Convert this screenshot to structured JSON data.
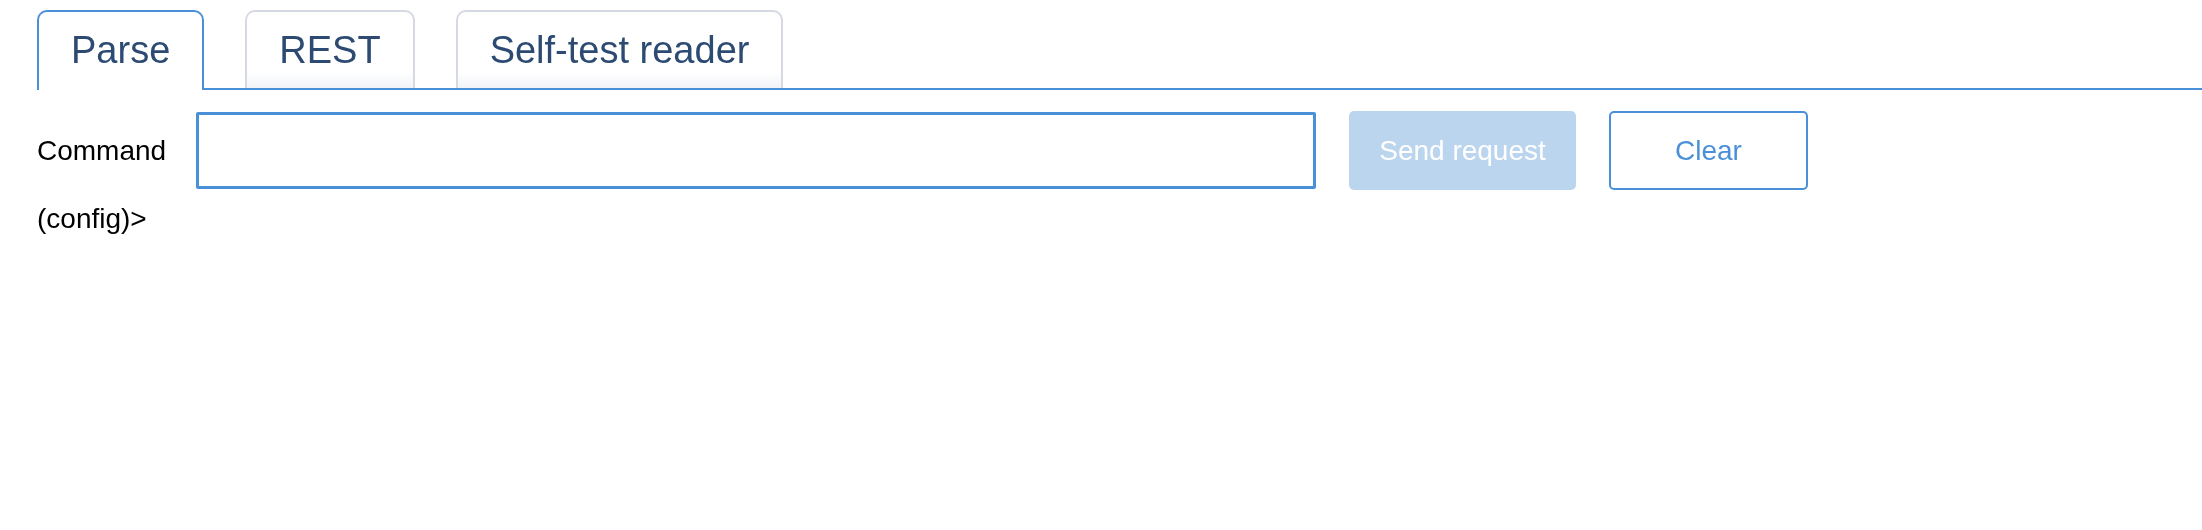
{
  "tabs": [
    {
      "label": "Parse",
      "selected": true
    },
    {
      "label": "REST",
      "selected": false
    },
    {
      "label": "Self-test reader",
      "selected": false
    }
  ],
  "command": {
    "label": "Command",
    "prompt": "(config)>"
  },
  "buttons": [
    {
      "label": "Send request",
      "kind": "primary",
      "disabled": true
    },
    {
      "label": "Clear",
      "kind": "outline",
      "disabled": false
    }
  ]
}
